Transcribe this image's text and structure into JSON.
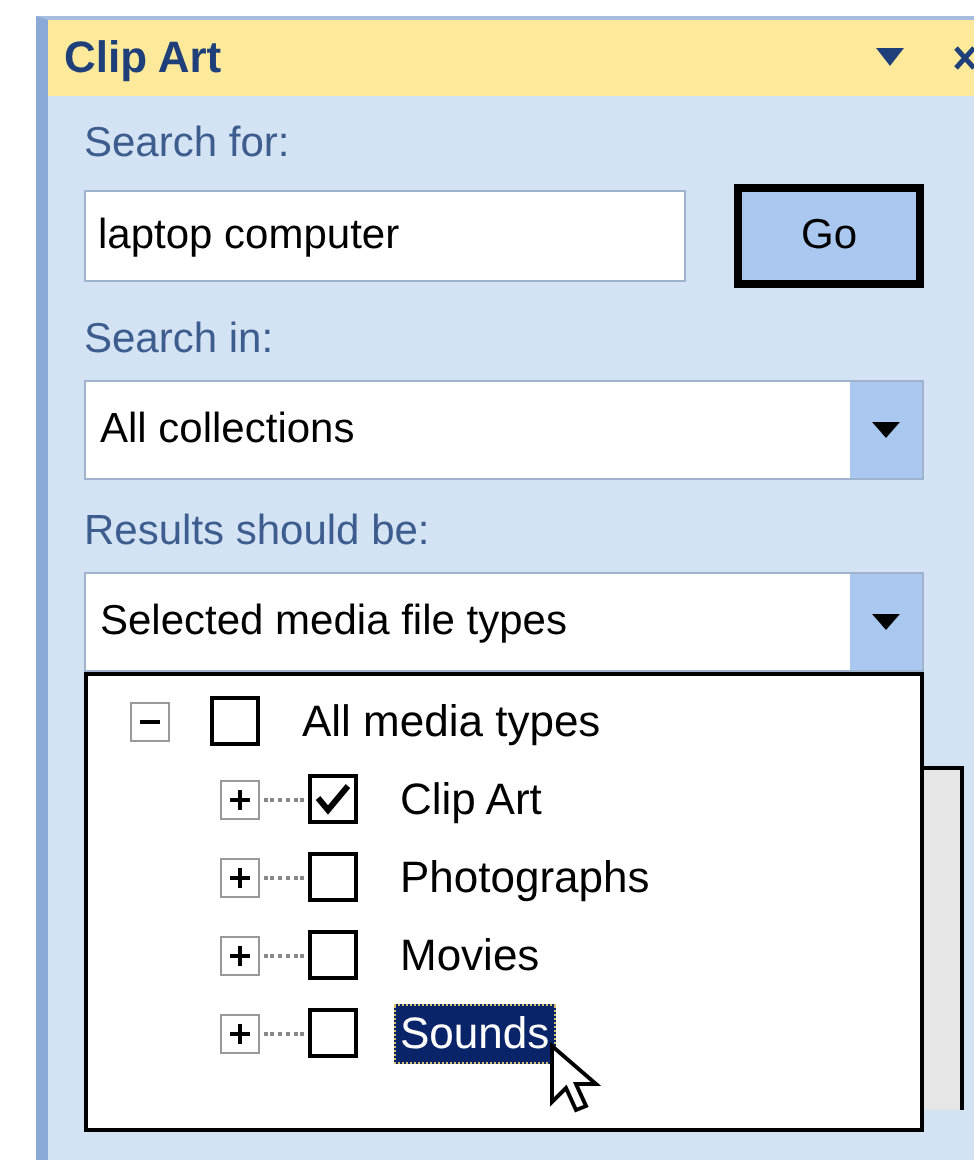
{
  "panel": {
    "title": "Clip Art"
  },
  "search_for": {
    "label": "Search for:",
    "value": "laptop computer"
  },
  "go_button": {
    "label": "Go"
  },
  "search_in": {
    "label": "Search in:",
    "value": "All collections"
  },
  "results": {
    "label": "Results should be:",
    "value": "Selected media file types",
    "expanded": true
  },
  "media_tree": [
    {
      "label": "All media types",
      "checked": false,
      "expanded": true,
      "selected": false,
      "children": [
        {
          "label": "Clip Art",
          "checked": true,
          "expanded": false,
          "selected": false
        },
        {
          "label": "Photographs",
          "checked": false,
          "expanded": false,
          "selected": false
        },
        {
          "label": "Movies",
          "checked": false,
          "expanded": false,
          "selected": false
        },
        {
          "label": "Sounds",
          "checked": false,
          "expanded": false,
          "selected": true
        }
      ]
    }
  ]
}
